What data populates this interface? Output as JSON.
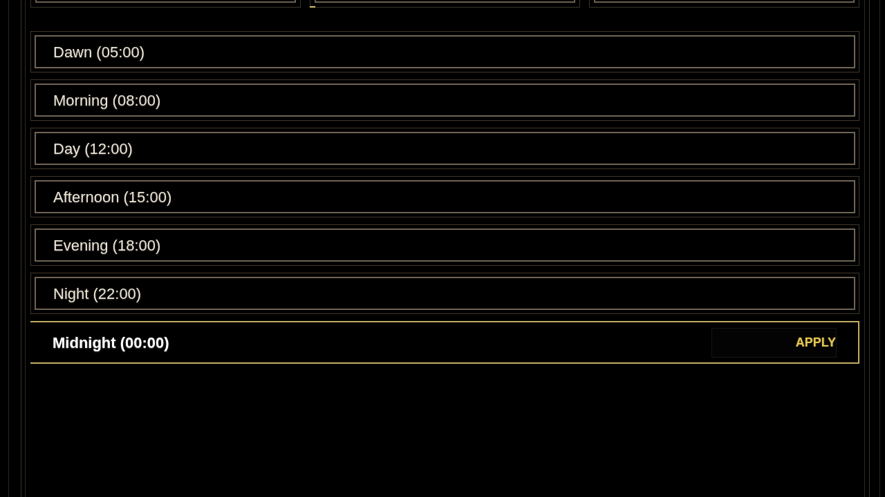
{
  "time_presets": [
    {
      "label": "Dawn (05:00)",
      "selected": false
    },
    {
      "label": "Morning (08:00)",
      "selected": false
    },
    {
      "label": "Day (12:00)",
      "selected": false
    },
    {
      "label": "Afternoon (15:00)",
      "selected": false
    },
    {
      "label": "Evening (18:00)",
      "selected": false
    },
    {
      "label": "Night (22:00)",
      "selected": false
    },
    {
      "label": "Midnight (00:00)",
      "selected": true
    }
  ],
  "apply_button": {
    "label": "APPLY"
  }
}
